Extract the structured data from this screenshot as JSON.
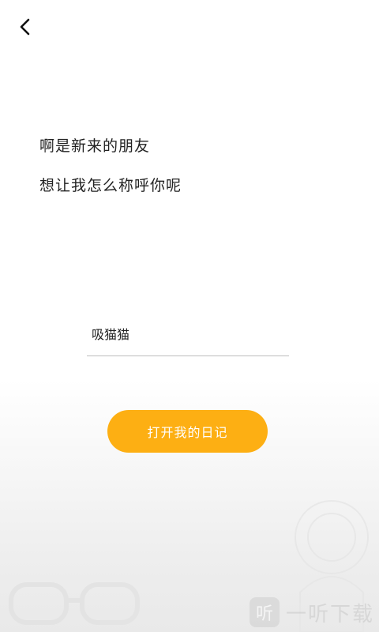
{
  "nav": {
    "back_icon": "chevron-left-icon"
  },
  "greeting": {
    "line1": "啊是新来的朋友",
    "line2": "想让我怎么称呼你呢"
  },
  "nickname": {
    "value": "吸猫猫"
  },
  "actions": {
    "open_diary_label": "打开我的日记",
    "accent_color": "#fdaf13"
  },
  "watermark": {
    "logo_glyph": "听",
    "text": "一听下载"
  }
}
